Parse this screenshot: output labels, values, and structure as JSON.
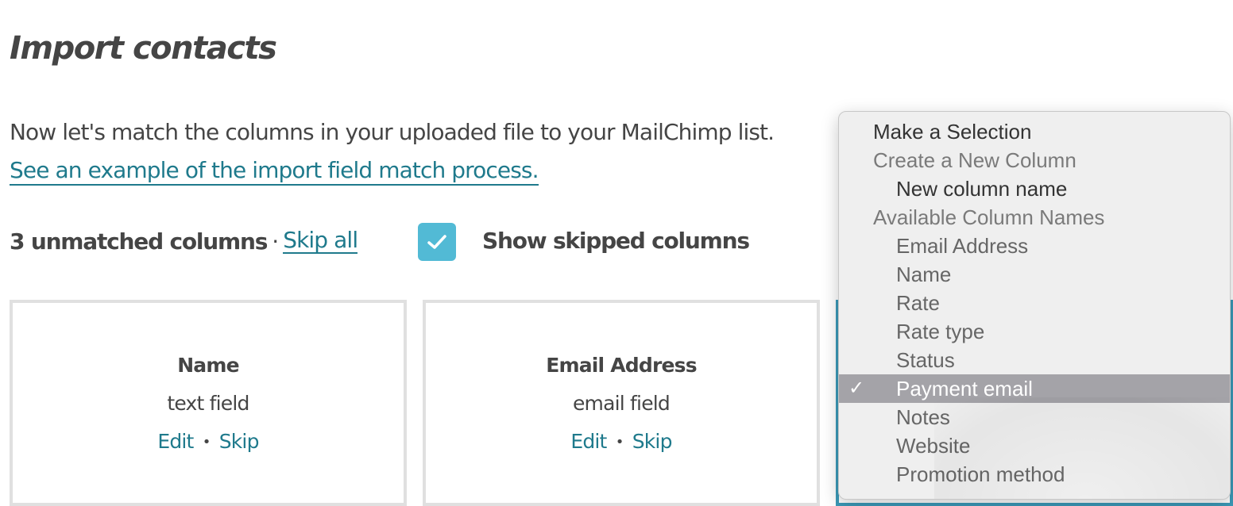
{
  "page": {
    "title": "Import contacts",
    "intro_text": "Now let's match the columns in your uploaded file to your MailChimp list.",
    "example_link": "See an example of the import field match process."
  },
  "status": {
    "unmatched_label": "3 unmatched columns",
    "separator": "·",
    "skip_all_label": "Skip all",
    "show_skipped_label": "Show skipped columns",
    "show_skipped_checked": true
  },
  "colors": {
    "accent_link": "#1f7a8c",
    "checkbox_fill": "#52bad5",
    "active_card_border": "#3b9ab8",
    "card_border": "#e0e0e0",
    "dropdown_bg": "#efefef",
    "selected_option_bg": "#a4a3a8"
  },
  "cards": [
    {
      "name": "Name",
      "type": "text field",
      "edit_label": "Edit",
      "separator": "•",
      "skip_label": "Skip"
    },
    {
      "name": "Email Address",
      "type": "email field",
      "edit_label": "Edit",
      "separator": "•",
      "skip_label": "Skip"
    }
  ],
  "dropdown": {
    "selected_value": "Payment email",
    "check_glyph": "✓",
    "options": [
      {
        "label": "Make a Selection",
        "kind": "top"
      },
      {
        "label": "Create a New Column",
        "kind": "group"
      },
      {
        "label": "New column name",
        "kind": "child-dark"
      },
      {
        "label": "Available Column Names",
        "kind": "group"
      },
      {
        "label": "Email Address",
        "kind": "child"
      },
      {
        "label": "Name",
        "kind": "child"
      },
      {
        "label": "Rate",
        "kind": "child"
      },
      {
        "label": "Rate type",
        "kind": "child"
      },
      {
        "label": "Status",
        "kind": "child"
      },
      {
        "label": "Payment email",
        "kind": "child",
        "selected": true
      },
      {
        "label": "Notes",
        "kind": "child"
      },
      {
        "label": "Website",
        "kind": "child"
      },
      {
        "label": "Promotion method",
        "kind": "child"
      }
    ]
  }
}
